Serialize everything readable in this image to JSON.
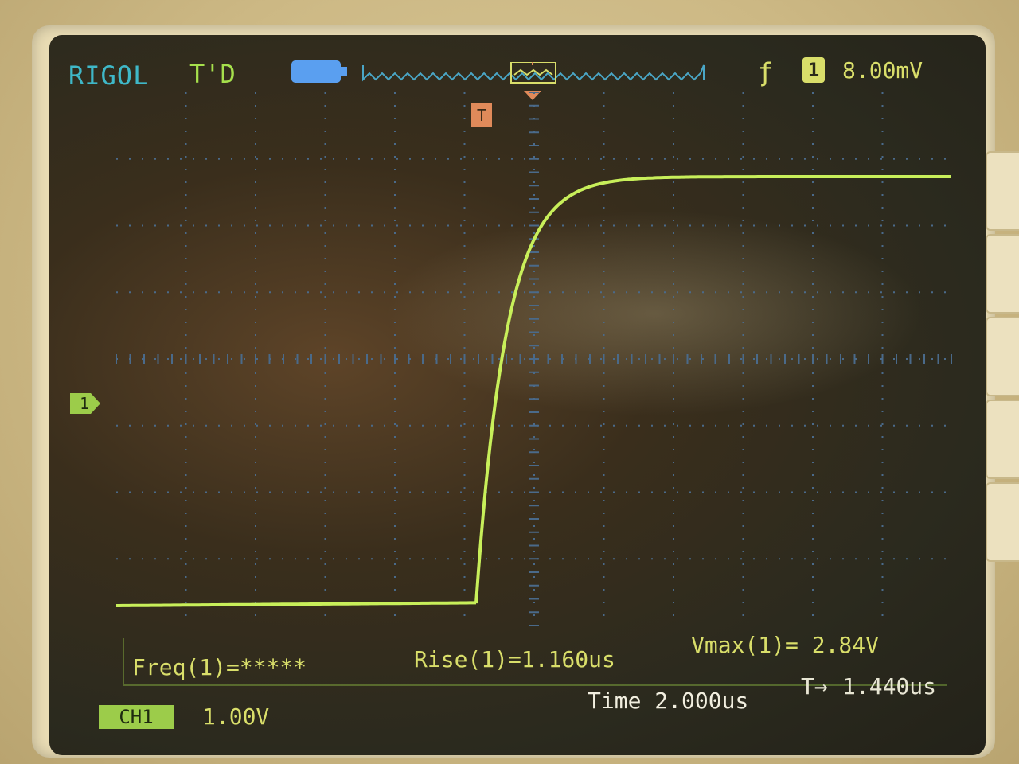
{
  "header": {
    "brand": "RIGOL",
    "run_status": "T'D",
    "trigger_edge_icon": "rising-edge-icon",
    "trigger_source_label": "1",
    "trigger_level": "8.00mV"
  },
  "markers": {
    "trigger_position_label": "T",
    "ch1_ground_label": "1"
  },
  "measurements": {
    "freq": "Freq(1)=*****",
    "rise": "Rise(1)=1.160us",
    "vmax": "Vmax(1)= 2.84V"
  },
  "footer": {
    "ch1_badge": "CH1",
    "ch1_scale": "1.00V",
    "timebase": "Time 2.000us",
    "trigger_offset_icon": "T→",
    "trigger_offset": "1.440us"
  },
  "colors": {
    "trace": "#c8ef5a",
    "text_cyan": "#3fb8c8",
    "text_green": "#a6e04c",
    "text_yellow": "#d9de6a",
    "trigger_marker": "#e08a5a"
  }
}
